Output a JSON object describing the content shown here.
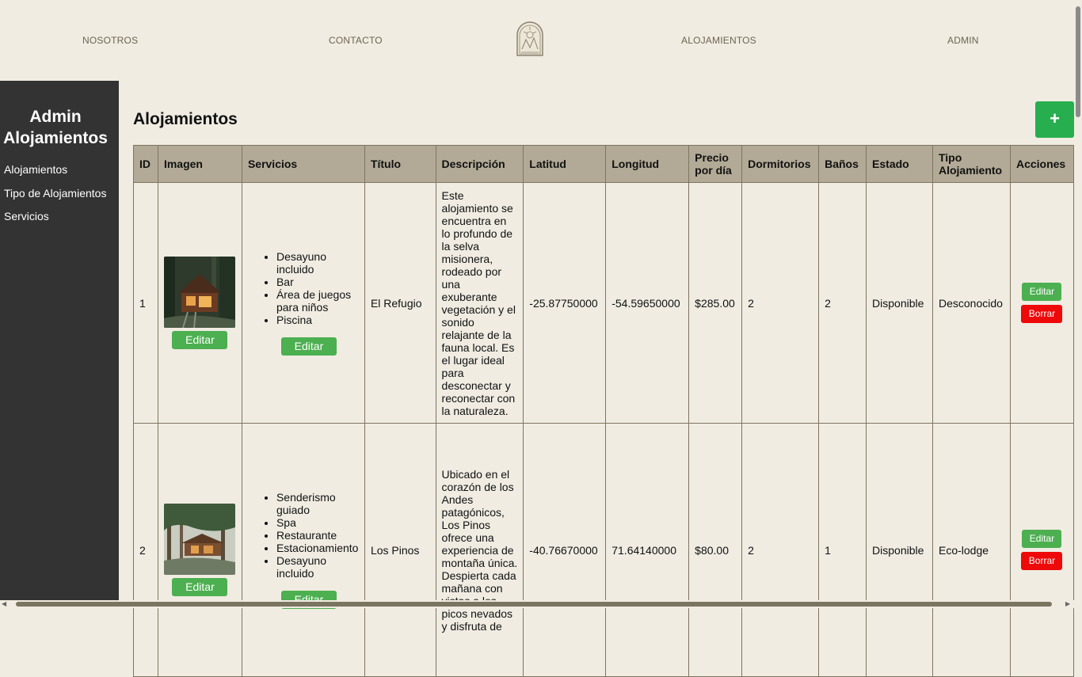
{
  "nav": {
    "nosotros": "NOSOTROS",
    "contacto": "CONTACTO",
    "alojamientos": "ALOJAMIENTOS",
    "admin": "ADMIN"
  },
  "sidebar": {
    "title_line1": "Admin",
    "title_line2": "Alojamientos",
    "items": [
      {
        "label": "Alojamientos"
      },
      {
        "label": "Tipo de Alojamientos"
      },
      {
        "label": "Servicios"
      }
    ]
  },
  "main": {
    "title": "Alojamientos",
    "add_label": "+",
    "columns": {
      "id": "ID",
      "imagen": "Imagen",
      "servicios": "Servicios",
      "titulo": "Título",
      "descripcion": "Descripción",
      "latitud": "Latitud",
      "longitud": "Longitud",
      "precio": "Precio por día",
      "dormitorios": "Dormitorios",
      "banos": "Baños",
      "estado": "Estado",
      "tipo": "Tipo Alojamiento",
      "acciones": "Acciones"
    },
    "edit_label": "Editar",
    "delete_label": "Borrar",
    "rows": [
      {
        "id": "1",
        "servicios": [
          "Desayuno incluido",
          "Bar",
          "Área de juegos para niños",
          "Piscina"
        ],
        "titulo": "El Refugio",
        "descripcion": "Este alojamiento se encuentra en lo profundo de la selva misionera, rodeado por una exuberante vegetación y el sonido relajante de la fauna local. Es el lugar ideal para desconectar y reconectar con la naturaleza.",
        "latitud": "-25.87750000",
        "longitud": "-54.59650000",
        "precio": "$285.00",
        "dormitorios": "2",
        "banos": "2",
        "estado": "Disponible",
        "tipo": "Desconocido"
      },
      {
        "id": "2",
        "servicios": [
          "Senderismo guiado",
          "Spa",
          "Restaurante",
          "Estacionamiento",
          "Desayuno incluido"
        ],
        "titulo": "Los Pinos",
        "descripcion": "Ubicado en el corazón de los Andes patagónicos, Los Pinos ofrece una experiencia de montaña única. Despierta cada mañana con vistas a los picos nevados y disfruta de",
        "latitud": "-40.76670000",
        "longitud": "71.64140000",
        "precio": "$80.00",
        "dormitorios": "2",
        "banos": "1",
        "estado": "Disponible",
        "tipo": "Eco-lodge"
      }
    ]
  }
}
